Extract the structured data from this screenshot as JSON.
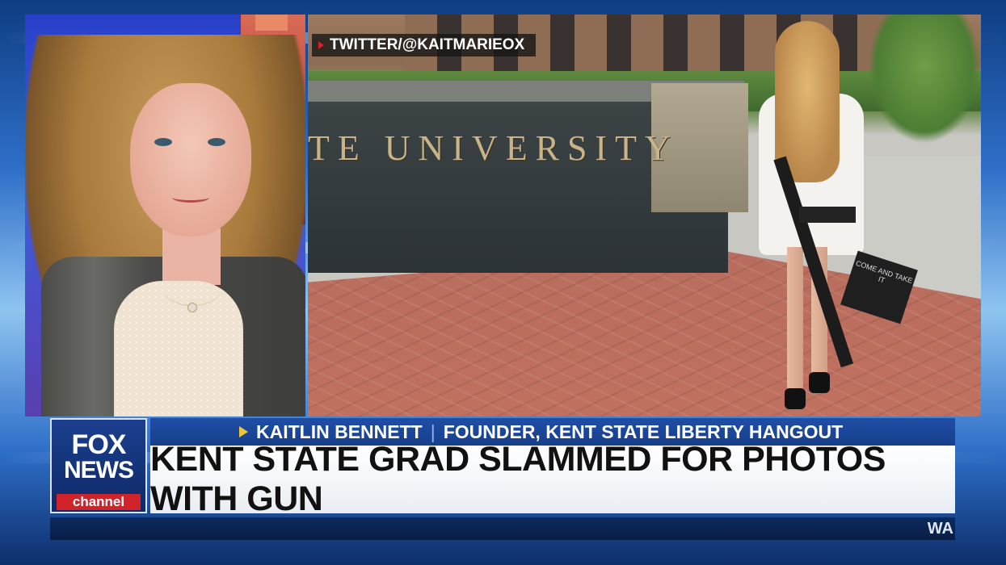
{
  "source_tag": "TWITTER/@KAITMARIEOX",
  "wall_sign_text": "TE UNIVERSITY",
  "cap_text": "COME AND TAKE IT",
  "network": {
    "logo_line1": "FOX",
    "logo_line2": "NEWS",
    "logo_line3": "channel"
  },
  "lower_third": {
    "name": "KAITLIN BENNETT",
    "separator": "|",
    "role": "FOUNDER, KENT STATE LIBERTY HANGOUT",
    "headline": "KENT STATE GRAD SLAMMED FOR PHOTOS WITH GUN"
  },
  "ticker": {
    "text": "WA"
  },
  "colors": {
    "network_blue": "#1f4ea6",
    "network_red": "#d2232a",
    "accent_yellow": "#f0c43a"
  }
}
